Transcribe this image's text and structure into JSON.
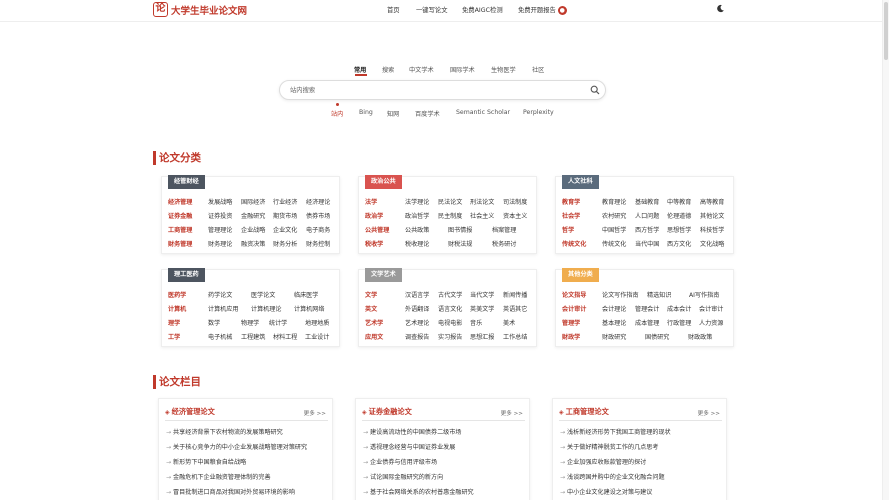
{
  "header": {
    "logo_glyph": "论",
    "logo_text": "大学生毕业论文网",
    "nav": [
      "首页",
      "一键写论文",
      "免费AIGC检测",
      "免费开题报告"
    ],
    "fire_icon": "fire-badge-icon",
    "theme_icon": "moon-icon"
  },
  "search": {
    "tabs": [
      "常用",
      "搜索",
      "中文学术",
      "国际学术",
      "生物医学",
      "社区"
    ],
    "active_tab": "常用",
    "placeholder": "站内搜索",
    "value": "",
    "engines": [
      "站内",
      "Bing",
      "知网",
      "百度学术",
      "Semantic Scholar",
      "Perplexity"
    ],
    "active_engine": "站内"
  },
  "sections": {
    "categories_title": "论文分类",
    "columns_title": "论文栏目"
  },
  "colors": {
    "accent": "#c0392b",
    "econ": "#4d5560",
    "politics": "#d9534f",
    "humanities": "#5a6b7c",
    "sci": "#4d5560",
    "arts": "#9a9a9a",
    "other": "#f0ad4e"
  },
  "categories": [
    {
      "title": "经管财经",
      "rows": [
        {
          "lead": "经济管理",
          "items": [
            "发展战略",
            "国际经济",
            "行业经济",
            "经济理论"
          ]
        },
        {
          "lead": "证券金融",
          "items": [
            "证券投资",
            "金融研究",
            "期货市场",
            "债券市场"
          ]
        },
        {
          "lead": "工商管理",
          "items": [
            "管理理论",
            "企业战略",
            "企业文化",
            "电子商务"
          ]
        },
        {
          "lead": "财务管理",
          "items": [
            "财务理论",
            "融资决策",
            "财务分析",
            "财务控制"
          ]
        }
      ]
    },
    {
      "title": "政治公共",
      "rows": [
        {
          "lead": "法学",
          "items": [
            "法学理论",
            "民法论文",
            "刑法论文",
            "司法制度"
          ]
        },
        {
          "lead": "政治学",
          "items": [
            "政治哲学",
            "民主制度",
            "社会主义",
            "资本主义"
          ]
        },
        {
          "lead": "公共管理",
          "items": [
            "公共政策",
            "图书情报",
            "档案管理"
          ]
        },
        {
          "lead": "税收学",
          "items": [
            "税收理论",
            "财税法规",
            "税务研讨"
          ]
        }
      ]
    },
    {
      "title": "人文社科",
      "rows": [
        {
          "lead": "教育学",
          "items": [
            "教育理论",
            "基础教育",
            "中等教育",
            "高等教育"
          ]
        },
        {
          "lead": "社会学",
          "items": [
            "农村研究",
            "人口问题",
            "伦理道德",
            "其他论文"
          ]
        },
        {
          "lead": "哲学",
          "items": [
            "中国哲学",
            "西方哲学",
            "思想哲学",
            "科技哲学"
          ]
        },
        {
          "lead": "传统文化",
          "items": [
            "传统文化",
            "当代中国",
            "西方文化",
            "文化战略"
          ]
        }
      ]
    },
    {
      "title": "理工医药",
      "rows": [
        {
          "lead": "医药学",
          "items": [
            "药学论文",
            "医学论文",
            "临床医学"
          ]
        },
        {
          "lead": "计算机",
          "items": [
            "计算机应用",
            "计算机理论",
            "计算机网络"
          ]
        },
        {
          "lead": "理学",
          "items": [
            "数学",
            "物理学",
            "统计学",
            "地理地质"
          ]
        },
        {
          "lead": "工学",
          "items": [
            "电子机械",
            "工程建筑",
            "材料工程",
            "工业设计"
          ]
        }
      ]
    },
    {
      "title": "文学艺术",
      "rows": [
        {
          "lead": "文学",
          "items": [
            "汉语言学",
            "古代文学",
            "当代文学",
            "新闻传播"
          ]
        },
        {
          "lead": "英文",
          "items": [
            "外语翻译",
            "语言文化",
            "英美文学",
            "英语其它"
          ]
        },
        {
          "lead": "艺术学",
          "items": [
            "艺术理论",
            "电视电影",
            "音乐",
            "美术"
          ]
        },
        {
          "lead": "应用文",
          "items": [
            "调查报告",
            "实习报告",
            "思想汇报",
            "工作总结"
          ]
        }
      ]
    },
    {
      "title": "其他分类",
      "rows": [
        {
          "lead": "论文指导",
          "items": [
            "论文写作指南",
            "精选知识",
            "AI写作指南"
          ]
        },
        {
          "lead": "会计审计",
          "items": [
            "会计理论",
            "管理会计",
            "成本会计",
            "会计审计"
          ]
        },
        {
          "lead": "管理学",
          "items": [
            "基本理论",
            "成本管理",
            "行政管理",
            "人力资源"
          ]
        },
        {
          "lead": "财政学",
          "items": [
            "财政研究",
            "国债研究",
            "财政政策"
          ]
        }
      ]
    }
  ],
  "columns": [
    {
      "title": "经济管理论文",
      "more": "更多 >>",
      "articles": [
        "共享经济背景下农村物流的发展策略研究",
        "关于核心竞争力的中小企业发展战略管理对策研究",
        "新形势下中国粮食自给战略",
        "金融危机下企业融资管理体制的完善",
        "冒目批制进口商品对我国对外贸易环境的影响"
      ]
    },
    {
      "title": "证券金融论文",
      "more": "更多 >>",
      "articles": [
        "建设高流动性的中国债券二级市场",
        "透视理念经营与中国证券业发展",
        "企业债券与信用评级市场",
        "试论国际金融研究的新方向",
        "基于社会网络关系的农村普惠金融研究"
      ]
    },
    {
      "title": "工商管理论文",
      "more": "更多 >>",
      "articles": [
        "浅析新经济形势下我国工商管理的现状",
        "关于做好精神脱贫工作的几点思考",
        "企业加强应收账款管理的探讨",
        "浅谈跨国并购中的企业文化融合问题",
        "中小企业文化建设之对策与建议"
      ]
    }
  ]
}
